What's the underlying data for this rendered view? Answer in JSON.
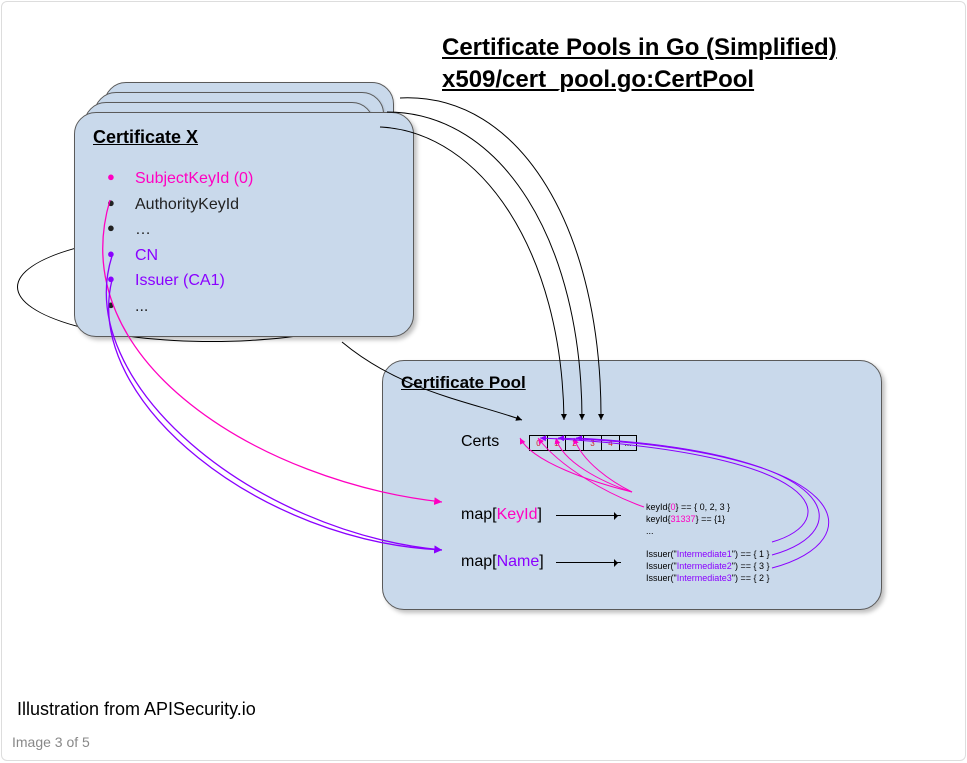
{
  "title_line1": "Certificate Pools in Go (Simplified)",
  "title_line2": "x509/cert_pool.go:CertPool",
  "card": {
    "title": "Certificate X",
    "items": {
      "ski": "SubjectKeyId (0)",
      "aki": "AuthorityKeyId",
      "dots1": "…",
      "cn": "CN",
      "issuer": "Issuer (CA1)",
      "dots2": "..."
    }
  },
  "pool": {
    "title": "Certificate Pool",
    "certs_label": "Certs",
    "map_key_prefix": "map[",
    "map_key_key": "KeyId",
    "map_key_suffix": "]",
    "map_name_prefix": "map[",
    "map_name_key": "Name",
    "map_name_suffix": "]",
    "cells": [
      "0",
      "1",
      "2",
      "3",
      "4",
      "..."
    ],
    "keylines": {
      "l1a": "keyId{",
      "l1b": "0",
      "l1c": "} == { 0, 2, 3 }",
      "l2a": "keyId{",
      "l2b": "31337",
      "l2c": "} == {1}",
      "l3": "..."
    },
    "isslines": {
      "l1a": "Issuer(\"",
      "l1b": "Intermediate1",
      "l1c": "\") == { 1 }",
      "l2a": "Issuer(\"",
      "l2b": "Intermediate2",
      "l2c": "\") == { 3 }",
      "l3a": "Issuer(\"",
      "l3b": "Intermediate3",
      "l3c": "\") == { 2 }"
    }
  },
  "caption": "Illustration from APISecurity.io",
  "counter": "Image 3 of 5"
}
